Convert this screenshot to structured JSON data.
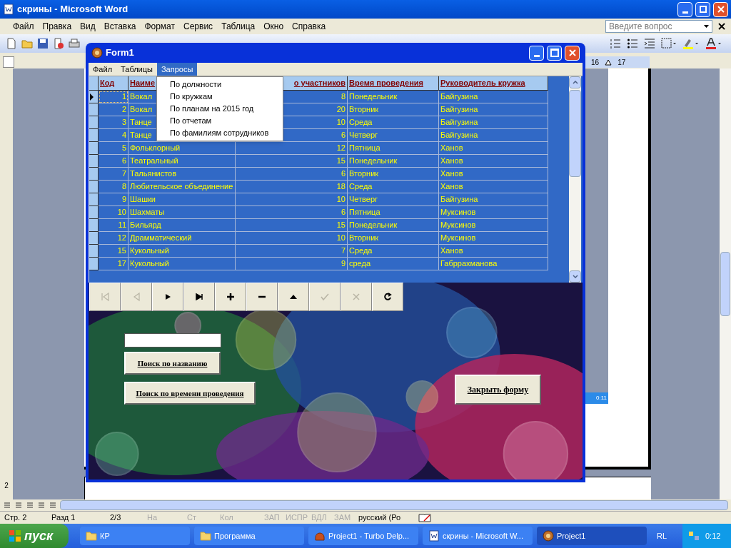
{
  "word": {
    "title": "скрины - Microsoft Word",
    "menu": [
      "Файл",
      "Правка",
      "Вид",
      "Вставка",
      "Формат",
      "Сервис",
      "Таблица",
      "Окно",
      "Справка"
    ],
    "help_placeholder": "Введите вопрос",
    "ruler": [
      "16",
      "17"
    ],
    "vertical_ruler": "2",
    "embedded_clock": "0:11",
    "status_bar": [
      {
        "text": "Стр. 2",
        "disabled": false
      },
      {
        "text": "Разд 1",
        "disabled": false
      },
      {
        "text": "2/3",
        "disabled": false
      },
      {
        "text": "На",
        "disabled": true
      },
      {
        "text": "Ст",
        "disabled": true
      },
      {
        "text": "Кол",
        "disabled": true
      },
      {
        "text": "ЗАП",
        "disabled": true
      },
      {
        "text": "ИСПР",
        "disabled": true
      },
      {
        "text": "ВДЛ",
        "disabled": true
      },
      {
        "text": "ЗАМ",
        "disabled": true
      },
      {
        "text": "русский (Ро",
        "disabled": false
      }
    ]
  },
  "form": {
    "title": "Form1",
    "menu": [
      {
        "label": "Файл",
        "selected": false
      },
      {
        "label": "Таблицы",
        "selected": false
      },
      {
        "label": "Запросы",
        "selected": true
      }
    ],
    "dropdown": [
      "По должности",
      "По кружкам",
      "По планам на 2015 год",
      "По отчетам",
      "По фамилиям сотрудников"
    ],
    "grid": {
      "columns": [
        "Код",
        "Наиме",
        "о  участников",
        "Время  проведения",
        "Руководитель  кружка"
      ],
      "rows": [
        {
          "selected": true,
          "cells": [
            "1",
            "Вокал",
            "8",
            "Понедельник",
            "Байгузина"
          ]
        },
        {
          "selected": false,
          "cells": [
            "2",
            "Вокал",
            "20",
            "Вторник",
            "Байгузина"
          ]
        },
        {
          "selected": false,
          "cells": [
            "3",
            "Танце",
            "10",
            "Среда",
            "Байгузина"
          ]
        },
        {
          "selected": false,
          "cells": [
            "4",
            "Танце",
            "6",
            "Четверг",
            "Байгузина"
          ]
        },
        {
          "selected": false,
          "cells": [
            "5",
            "Фольклорный",
            "12",
            "Пятница",
            "Ханов"
          ]
        },
        {
          "selected": false,
          "cells": [
            "6",
            "Театральный",
            "15",
            "Понедельник",
            "Ханов"
          ]
        },
        {
          "selected": false,
          "cells": [
            "7",
            "Тальянистов",
            "6",
            "Вторник",
            "Ханов"
          ]
        },
        {
          "selected": false,
          "cells": [
            "8",
            "Любительское объединение",
            "18",
            "Среда",
            "Ханов"
          ]
        },
        {
          "selected": false,
          "cells": [
            "9",
            "Шашки",
            "10",
            "Четверг",
            "Байгузина"
          ]
        },
        {
          "selected": false,
          "cells": [
            "10",
            "Шахматы",
            "6",
            "Пятница",
            "Муксинов"
          ]
        },
        {
          "selected": false,
          "cells": [
            "11",
            "Бильярд",
            "15",
            "Понедельник",
            "Муксинов"
          ]
        },
        {
          "selected": false,
          "cells": [
            "12",
            "Драмматический",
            "10",
            "Вторник",
            "Муксинов"
          ]
        },
        {
          "selected": false,
          "cells": [
            "15",
            "Кукольный",
            "7",
            "Среда",
            "Ханов"
          ]
        },
        {
          "selected": false,
          "cells": [
            "17",
            "Кукольный",
            "9",
            "среда",
            "Габррахманова"
          ]
        }
      ]
    },
    "navigator": [
      {
        "kind": "first",
        "disabled": true
      },
      {
        "kind": "prior",
        "disabled": true
      },
      {
        "kind": "next",
        "disabled": false
      },
      {
        "kind": "last",
        "disabled": false
      },
      {
        "kind": "insert",
        "disabled": false
      },
      {
        "kind": "delete",
        "disabled": false
      },
      {
        "kind": "edit",
        "disabled": false
      },
      {
        "kind": "post",
        "disabled": true
      },
      {
        "kind": "cancel",
        "disabled": true
      },
      {
        "kind": "refresh",
        "disabled": false
      }
    ],
    "buttons": [
      "Поиск по названию",
      "Поиск по времени проведения",
      "Закрыть форму"
    ]
  },
  "taskbar": {
    "start": "пуск",
    "tasks": [
      {
        "label": "КР",
        "kind": "folder",
        "selected": false
      },
      {
        "label": "Программа",
        "kind": "folder",
        "selected": false
      },
      {
        "label": "Project1 - Turbo Delp...",
        "kind": "ide",
        "selected": false
      },
      {
        "label": "скрины - Microsoft W...",
        "kind": "word",
        "selected": false
      },
      {
        "label": "Project1",
        "kind": "app",
        "selected": true
      }
    ],
    "language": "RL",
    "clock": "0:12"
  }
}
